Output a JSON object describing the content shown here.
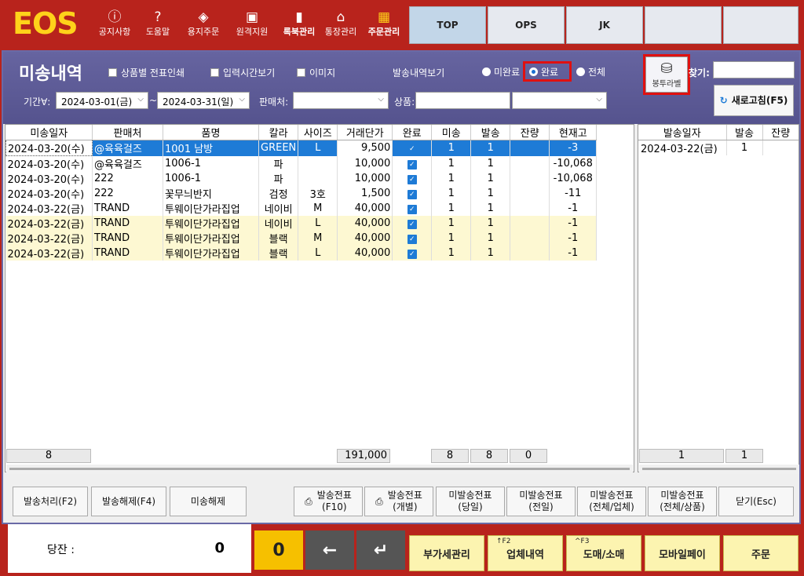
{
  "app": {
    "logo": "EOS"
  },
  "top_menu": [
    {
      "label": "공지사항",
      "icon": "alert-icon",
      "glyph": "ⓘ"
    },
    {
      "label": "도움말",
      "icon": "help-icon",
      "glyph": "?"
    },
    {
      "label": "용지주문",
      "icon": "layers-icon",
      "glyph": "◈"
    },
    {
      "label": "원격지원",
      "icon": "monitor-icon",
      "glyph": "▣"
    },
    {
      "label": "록북관리",
      "icon": "book-icon",
      "glyph": "▮"
    },
    {
      "label": "통장관리",
      "icon": "bank-icon",
      "glyph": "⌂"
    },
    {
      "label": "주문관리",
      "icon": "box-icon",
      "glyph": "▦"
    }
  ],
  "top_tabs": [
    "TOP",
    "OPS",
    "JK",
    "",
    ""
  ],
  "window": {
    "title": "미송내역",
    "checks": [
      "상품별 전표인쇄",
      "입력시간보기",
      "이미지"
    ],
    "view_label": "발송내역보기",
    "radios": [
      "미완료",
      "완료",
      "전체"
    ],
    "bong_label": "봉투라벨",
    "search_label": "찾기:",
    "refresh_label": "새로고침(F5)",
    "period_label": "기간∀:",
    "date_from": "2024-03-01(금)",
    "tilde": "~",
    "date_to": "2024-03-31(일)",
    "seller_label": "판매처:",
    "product_label": "상품:"
  },
  "grid": {
    "headers": [
      "미송일자",
      "판매처",
      "품명",
      "칼라",
      "사이즈",
      "거래단가",
      "완료",
      "미송",
      "발송",
      "잔량",
      "현재고"
    ],
    "rows": [
      [
        "2024-03-20(수)",
        "@육육걸즈",
        "1001 남방",
        "GREEN",
        "L",
        "9,500",
        "✓",
        "1",
        "1",
        "",
        "-3"
      ],
      [
        "2024-03-20(수)",
        "@육육걸즈",
        "1006-1",
        "파",
        "",
        "10,000",
        "✓",
        "1",
        "1",
        "",
        "-10,068"
      ],
      [
        "2024-03-20(수)",
        "222",
        "1006-1",
        "파",
        "",
        "10,000",
        "✓",
        "1",
        "1",
        "",
        "-10,068"
      ],
      [
        "2024-03-20(수)",
        "222",
        "꽃무늬반지",
        "검정",
        "3호",
        "1,500",
        "✓",
        "1",
        "1",
        "",
        "-11"
      ],
      [
        "2024-03-22(금)",
        "TRAND",
        "투웨이단가라집업",
        "네이비",
        "M",
        "40,000",
        "✓",
        "1",
        "1",
        "",
        "-1"
      ],
      [
        "2024-03-22(금)",
        "TRAND",
        "투웨이단가라집업",
        "네이비",
        "L",
        "40,000",
        "✓",
        "1",
        "1",
        "",
        "-1"
      ],
      [
        "2024-03-22(금)",
        "TRAND",
        "투웨이단가라집업",
        "블랙",
        "M",
        "40,000",
        "✓",
        "1",
        "1",
        "",
        "-1"
      ],
      [
        "2024-03-22(금)",
        "TRAND",
        "투웨이단가라집업",
        "블랙",
        "L",
        "40,000",
        "✓",
        "1",
        "1",
        "",
        "-1"
      ]
    ],
    "totals": {
      "count": "8",
      "amount": "191,000",
      "misong": "8",
      "balsong": "8",
      "jan": "0"
    }
  },
  "right_grid": {
    "headers": [
      "발송일자",
      "발송",
      "잔량"
    ],
    "rows": [
      [
        "2024-03-22(금)",
        "1",
        ""
      ]
    ],
    "totals": {
      "a": "1",
      "b": "1"
    }
  },
  "actions": {
    "ship": "발송처리(F2)",
    "unship": "발송해제(F4)",
    "misong_release": "미송해제",
    "slip_f10": [
      "발송전표",
      "(F10)"
    ],
    "slip_each": [
      "발송전표",
      "(개별)"
    ],
    "unslip_today": [
      "미발송전표",
      "(당일)"
    ],
    "unslip_all_day": [
      "미발송전표",
      "(전일)"
    ],
    "unslip_all_vendor": [
      "미발송전표",
      "(전체/업체)"
    ],
    "unslip_all_product": [
      "미발송전표",
      "(전체/상품)"
    ],
    "close": "닫기(Esc)"
  },
  "bottom": {
    "dangjan_label": "당잔 :",
    "dangjan_value": "0",
    "zero": "0",
    "buttons": [
      {
        "label": "부가세관리",
        "key": ""
      },
      {
        "label": "업체내역",
        "key": "↑F2"
      },
      {
        "label": "도매/소매",
        "key": "^F3"
      },
      {
        "label": "모바일페이",
        "key": ""
      },
      {
        "label": "주문",
        "key": ""
      }
    ]
  }
}
